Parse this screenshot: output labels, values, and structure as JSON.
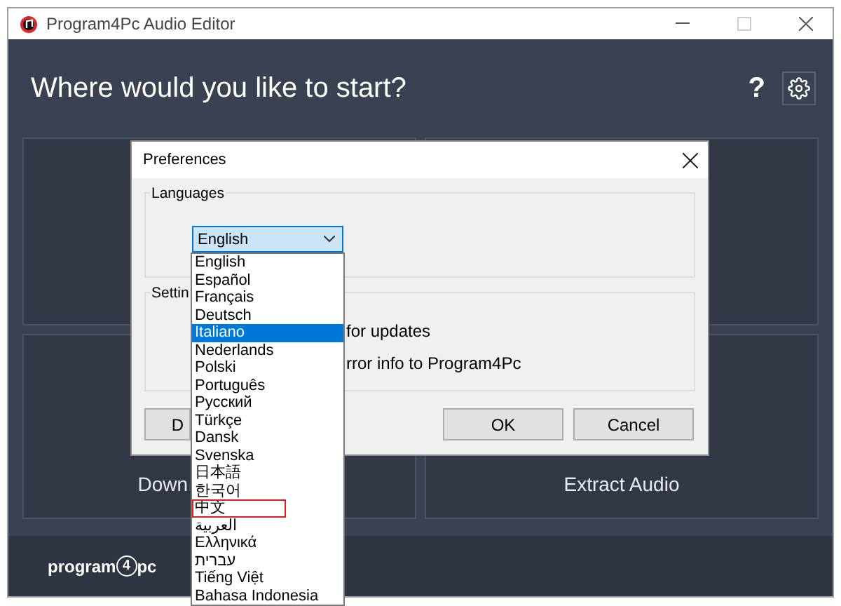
{
  "window": {
    "title": "Program4Pc Audio Editor"
  },
  "header": {
    "title": "Where would you like to start?",
    "help": "?"
  },
  "tiles": [
    {
      "kind": "blank"
    },
    {
      "kind": "blank"
    },
    {
      "kind": "cut",
      "label": "Down"
    },
    {
      "kind": "full",
      "label": "Extract Audio"
    }
  ],
  "logo": {
    "before": "program",
    "mark": "4",
    "after": "pc"
  },
  "dialog": {
    "title": "Preferences",
    "languages_group": "Languages",
    "combo_value": "English",
    "settings_group": "Settin",
    "settings_rows": [
      "for updates",
      "rror info to Program4Pc"
    ],
    "buttons": [
      {
        "label": "D",
        "kind": "partial"
      },
      {
        "label": "OK",
        "kind": "normal"
      },
      {
        "label": "Cancel",
        "kind": "normal"
      }
    ]
  },
  "language_list": [
    {
      "label": "English",
      "selected": false,
      "highlighted": false
    },
    {
      "label": "Español",
      "selected": false,
      "highlighted": false
    },
    {
      "label": "Français",
      "selected": false,
      "highlighted": false
    },
    {
      "label": "Deutsch",
      "selected": false,
      "highlighted": false
    },
    {
      "label": "Italiano",
      "selected": true,
      "highlighted": false
    },
    {
      "label": "Nederlands",
      "selected": false,
      "highlighted": false
    },
    {
      "label": "Polski",
      "selected": false,
      "highlighted": false
    },
    {
      "label": "Português",
      "selected": false,
      "highlighted": false
    },
    {
      "label": "Русский",
      "selected": false,
      "highlighted": false
    },
    {
      "label": "Türkçe",
      "selected": false,
      "highlighted": false
    },
    {
      "label": "Dansk",
      "selected": false,
      "highlighted": false
    },
    {
      "label": "Svenska",
      "selected": false,
      "highlighted": false
    },
    {
      "label": "日本語",
      "selected": false,
      "highlighted": false
    },
    {
      "label": "한국어",
      "selected": false,
      "highlighted": false
    },
    {
      "label": "中文",
      "selected": false,
      "highlighted": true
    },
    {
      "label": "العربية",
      "selected": false,
      "highlighted": false
    },
    {
      "label": "Ελληνικά",
      "selected": false,
      "highlighted": false
    },
    {
      "label": "עברית",
      "selected": false,
      "highlighted": false
    },
    {
      "label": "Tiếng Việt",
      "selected": false,
      "highlighted": false
    },
    {
      "label": "Bahasa Indonesia",
      "selected": false,
      "highlighted": false
    }
  ]
}
